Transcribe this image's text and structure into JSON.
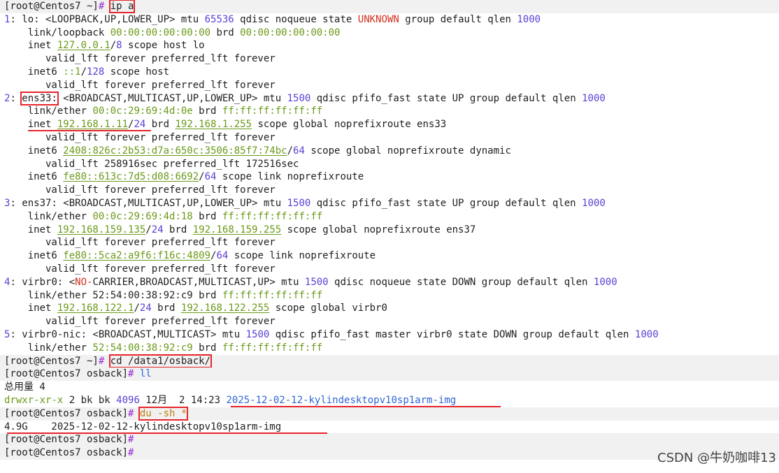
{
  "watermark": "CSDN @牛奶咖啡13",
  "colors": {
    "background": "#ffffff",
    "prompt_band": "#f1f1f1",
    "annotation_red": "#e6242b",
    "number": "#5b3fd6",
    "green": "#6a9a19",
    "blue": "#2f66d6",
    "orange": "#c17d13",
    "red": "#d0311f"
  },
  "lines": [
    {
      "band": true,
      "segs": [
        {
          "t": "[root@Centos7 ~]",
          "c": "plain"
        },
        {
          "t": "# ",
          "c": "sym"
        },
        {
          "t": "ip a",
          "c": "plain",
          "box": true
        }
      ]
    },
    {
      "segs": [
        {
          "t": "1",
          "c": "num"
        },
        {
          "t": ": lo: <LOOPBACK,UP,LOWER_UP> mtu ",
          "c": "plain"
        },
        {
          "t": "65536",
          "c": "num"
        },
        {
          "t": " qdisc noqueue state ",
          "c": "plain"
        },
        {
          "t": "UNKNOWN",
          "c": "red"
        },
        {
          "t": " group default qlen ",
          "c": "plain"
        },
        {
          "t": "1000",
          "c": "num"
        }
      ]
    },
    {
      "segs": [
        {
          "t": "    link/loopback ",
          "c": "plain"
        },
        {
          "t": "00:00:00:00:00:00",
          "c": "green"
        },
        {
          "t": " brd ",
          "c": "plain"
        },
        {
          "t": "00:00:00:00:00:00",
          "c": "green"
        }
      ]
    },
    {
      "segs": [
        {
          "t": "    inet ",
          "c": "plain"
        },
        {
          "t": "127.0.0.1",
          "c": "green",
          "ul": true
        },
        {
          "t": "/",
          "c": "plain"
        },
        {
          "t": "8",
          "c": "num"
        },
        {
          "t": " scope host lo",
          "c": "plain"
        }
      ]
    },
    {
      "segs": [
        {
          "t": "       valid_lft forever preferred_lft forever",
          "c": "plain"
        }
      ]
    },
    {
      "segs": [
        {
          "t": "    inet6 ",
          "c": "plain"
        },
        {
          "t": "::1",
          "c": "green"
        },
        {
          "t": "/",
          "c": "plain"
        },
        {
          "t": "128",
          "c": "num"
        },
        {
          "t": " scope host",
          "c": "plain"
        }
      ]
    },
    {
      "segs": [
        {
          "t": "       valid_lft forever preferred_lft forever",
          "c": "plain"
        }
      ]
    },
    {
      "segs": [
        {
          "t": "2",
          "c": "num"
        },
        {
          "t": ": ",
          "c": "plain"
        },
        {
          "t": "ens33:",
          "c": "plain",
          "box": true
        },
        {
          "t": " <BROADCAST,MULTICAST,UP,LOWER_UP> mtu ",
          "c": "plain"
        },
        {
          "t": "1500",
          "c": "num"
        },
        {
          "t": " qdisc pfifo_fast state UP group default qlen ",
          "c": "plain"
        },
        {
          "t": "1000",
          "c": "num"
        }
      ]
    },
    {
      "segs": [
        {
          "t": "    link/ether ",
          "c": "plain"
        },
        {
          "t": "00:0c:29:69:4d:0e",
          "c": "green"
        },
        {
          "t": " brd ",
          "c": "plain"
        },
        {
          "t": "ff:ff:ff:ff:ff:ff",
          "c": "green"
        }
      ]
    },
    {
      "segs": [
        {
          "t": "    inet ",
          "c": "plain"
        },
        {
          "t": "192.168.1.11",
          "c": "green",
          "ul": true
        },
        {
          "t": "/",
          "c": "plain"
        },
        {
          "t": "24",
          "c": "num"
        },
        {
          "t": " brd ",
          "c": "plain"
        },
        {
          "t": "192.168.1.255",
          "c": "green",
          "ul": true
        },
        {
          "t": " scope global noprefixroute ens33",
          "c": "plain"
        }
      ]
    },
    {
      "segs": [
        {
          "t": "       valid_lft forever preferred_lft forever",
          "c": "plain"
        }
      ]
    },
    {
      "segs": [
        {
          "t": "    inet6 ",
          "c": "plain"
        },
        {
          "t": "2408:826c:2b53:d7a:650c:3506:85f7:74bc",
          "c": "green",
          "ul": true
        },
        {
          "t": "/",
          "c": "plain"
        },
        {
          "t": "64",
          "c": "num"
        },
        {
          "t": " scope global noprefixroute dynamic",
          "c": "plain"
        }
      ]
    },
    {
      "segs": [
        {
          "t": "       valid_lft 258916sec preferred_lft 172516sec",
          "c": "plain"
        }
      ]
    },
    {
      "segs": [
        {
          "t": "    inet6 ",
          "c": "plain"
        },
        {
          "t": "fe80::613c:7d5:d08:6692",
          "c": "green",
          "ul": true
        },
        {
          "t": "/",
          "c": "plain"
        },
        {
          "t": "64",
          "c": "num"
        },
        {
          "t": " scope link noprefixroute",
          "c": "plain"
        }
      ]
    },
    {
      "segs": [
        {
          "t": "       valid_lft forever preferred_lft forever",
          "c": "plain"
        }
      ]
    },
    {
      "segs": [
        {
          "t": "3",
          "c": "num"
        },
        {
          "t": ": ens37: <BROADCAST,MULTICAST,UP,LOWER_UP> mtu ",
          "c": "plain"
        },
        {
          "t": "1500",
          "c": "num"
        },
        {
          "t": " qdisc pfifo_fast state UP group default qlen ",
          "c": "plain"
        },
        {
          "t": "1000",
          "c": "num"
        }
      ]
    },
    {
      "segs": [
        {
          "t": "    link/ether ",
          "c": "plain"
        },
        {
          "t": "00:0c:29:69:4d:18",
          "c": "green"
        },
        {
          "t": " brd ",
          "c": "plain"
        },
        {
          "t": "ff:ff:ff:ff:ff:ff",
          "c": "green"
        }
      ]
    },
    {
      "segs": [
        {
          "t": "    inet ",
          "c": "plain"
        },
        {
          "t": "192.168.159.135",
          "c": "green",
          "ul": true
        },
        {
          "t": "/",
          "c": "plain"
        },
        {
          "t": "24",
          "c": "num"
        },
        {
          "t": " brd ",
          "c": "plain"
        },
        {
          "t": "192.168.159.255",
          "c": "green",
          "ul": true
        },
        {
          "t": " scope global noprefixroute ens37",
          "c": "plain"
        }
      ]
    },
    {
      "segs": [
        {
          "t": "       valid_lft forever preferred_lft forever",
          "c": "plain"
        }
      ]
    },
    {
      "segs": [
        {
          "t": "    inet6 ",
          "c": "plain"
        },
        {
          "t": "fe80::5ca2:a9f6:f16c:4809",
          "c": "green",
          "ul": true
        },
        {
          "t": "/",
          "c": "plain"
        },
        {
          "t": "64",
          "c": "num"
        },
        {
          "t": " scope link noprefixroute",
          "c": "plain"
        }
      ]
    },
    {
      "segs": [
        {
          "t": "       valid_lft forever preferred_lft forever",
          "c": "plain"
        }
      ]
    },
    {
      "segs": [
        {
          "t": "4",
          "c": "num"
        },
        {
          "t": ": virbr0: <",
          "c": "plain"
        },
        {
          "t": "NO-",
          "c": "red"
        },
        {
          "t": "CARRIER,BROADCAST,MULTICAST,UP> mtu ",
          "c": "plain"
        },
        {
          "t": "1500",
          "c": "num"
        },
        {
          "t": " qdisc noqueue state DOWN group default qlen ",
          "c": "plain"
        },
        {
          "t": "1000",
          "c": "num"
        }
      ]
    },
    {
      "segs": [
        {
          "t": "    link/ether 52:54:00:38:92:c9 brd ",
          "c": "plain"
        },
        {
          "t": "ff:ff:ff:ff:ff:ff",
          "c": "green"
        }
      ]
    },
    {
      "segs": [
        {
          "t": "    inet ",
          "c": "plain"
        },
        {
          "t": "192.168.122.1",
          "c": "green",
          "ul": true
        },
        {
          "t": "/",
          "c": "plain"
        },
        {
          "t": "24",
          "c": "num"
        },
        {
          "t": " brd ",
          "c": "plain"
        },
        {
          "t": "192.168.122.255",
          "c": "green",
          "ul": true
        },
        {
          "t": " scope global virbr0",
          "c": "plain"
        }
      ]
    },
    {
      "segs": [
        {
          "t": "       valid_lft forever preferred_lft forever",
          "c": "plain"
        }
      ]
    },
    {
      "segs": [
        {
          "t": "5",
          "c": "num"
        },
        {
          "t": ": virbr0-nic: <BROADCAST,MULTICAST> mtu ",
          "c": "plain"
        },
        {
          "t": "1500",
          "c": "num"
        },
        {
          "t": " qdisc pfifo_fast master virbr0 state DOWN group default qlen ",
          "c": "plain"
        },
        {
          "t": "1000",
          "c": "num"
        }
      ]
    },
    {
      "segs": [
        {
          "t": "    link/ether ",
          "c": "plain"
        },
        {
          "t": "52:54:00:38:92:c9",
          "c": "green"
        },
        {
          "t": " brd ",
          "c": "plain"
        },
        {
          "t": "ff:ff:ff:ff:ff:ff",
          "c": "green"
        }
      ]
    },
    {
      "band": true,
      "segs": [
        {
          "t": "[root@Centos7 ~]",
          "c": "plain"
        },
        {
          "t": "# ",
          "c": "sym"
        },
        {
          "t": "cd /data1/osback/",
          "c": "plain",
          "box": true
        }
      ]
    },
    {
      "band": true,
      "segs": [
        {
          "t": "[root@Centos7 osback]",
          "c": "plain"
        },
        {
          "t": "# ",
          "c": "sym"
        },
        {
          "t": "ll",
          "c": "blue"
        }
      ]
    },
    {
      "segs": [
        {
          "t": "总用量 4",
          "c": "plain"
        }
      ]
    },
    {
      "segs": [
        {
          "t": "drwxr-xr-x",
          "c": "green"
        },
        {
          "t": " 2 bk bk ",
          "c": "plain"
        },
        {
          "t": "4096",
          "c": "num"
        },
        {
          "t": " 12月  2 14:23 ",
          "c": "plain"
        },
        {
          "t": "2025-12-02-12-kylindesktopv10sp1arm-img",
          "c": "blue"
        }
      ]
    },
    {
      "band": true,
      "segs": [
        {
          "t": "[root@Centos7 osback]",
          "c": "plain"
        },
        {
          "t": "# ",
          "c": "sym"
        },
        {
          "t": "du -sh *",
          "c": "orange",
          "box": true
        }
      ]
    },
    {
      "segs": [
        {
          "t": "4.9G    2025-12-02-12-kylindesktopv10sp1arm-img",
          "c": "plain"
        }
      ]
    },
    {
      "band": true,
      "segs": [
        {
          "t": "[root@Centos7 osback]",
          "c": "plain"
        },
        {
          "t": "#",
          "c": "sym"
        }
      ]
    },
    {
      "band": true,
      "segs": [
        {
          "t": "[root@Centos7 osback]",
          "c": "plain"
        },
        {
          "t": "#",
          "c": "sym"
        }
      ]
    }
  ]
}
